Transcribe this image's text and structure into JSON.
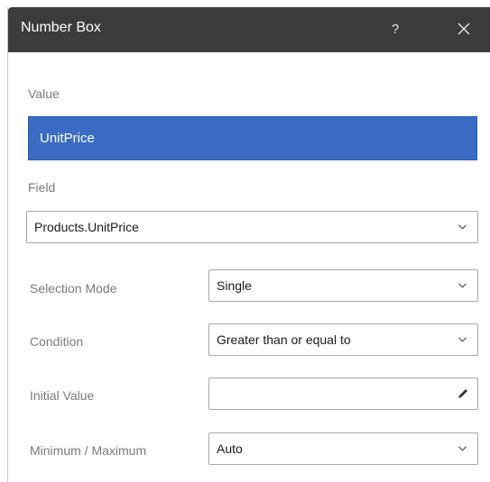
{
  "dialog": {
    "title": "Number Box",
    "help_label": "?",
    "close_icon": "close-icon"
  },
  "value": {
    "label": "Value",
    "selected": "UnitPrice"
  },
  "field": {
    "label": "Field",
    "selected": "Products.UnitPrice"
  },
  "selection_mode": {
    "label": "Selection Mode",
    "selected": "Single"
  },
  "condition": {
    "label": "Condition",
    "selected": "Greater than or equal to"
  },
  "initial_value": {
    "label": "Initial Value",
    "value": "",
    "edit_icon": "pencil-icon"
  },
  "min_max": {
    "label": "Minimum / Maximum",
    "selected": "Auto"
  },
  "colors": {
    "titlebar": "#3c3c3c",
    "selection": "#3b6cc4"
  }
}
